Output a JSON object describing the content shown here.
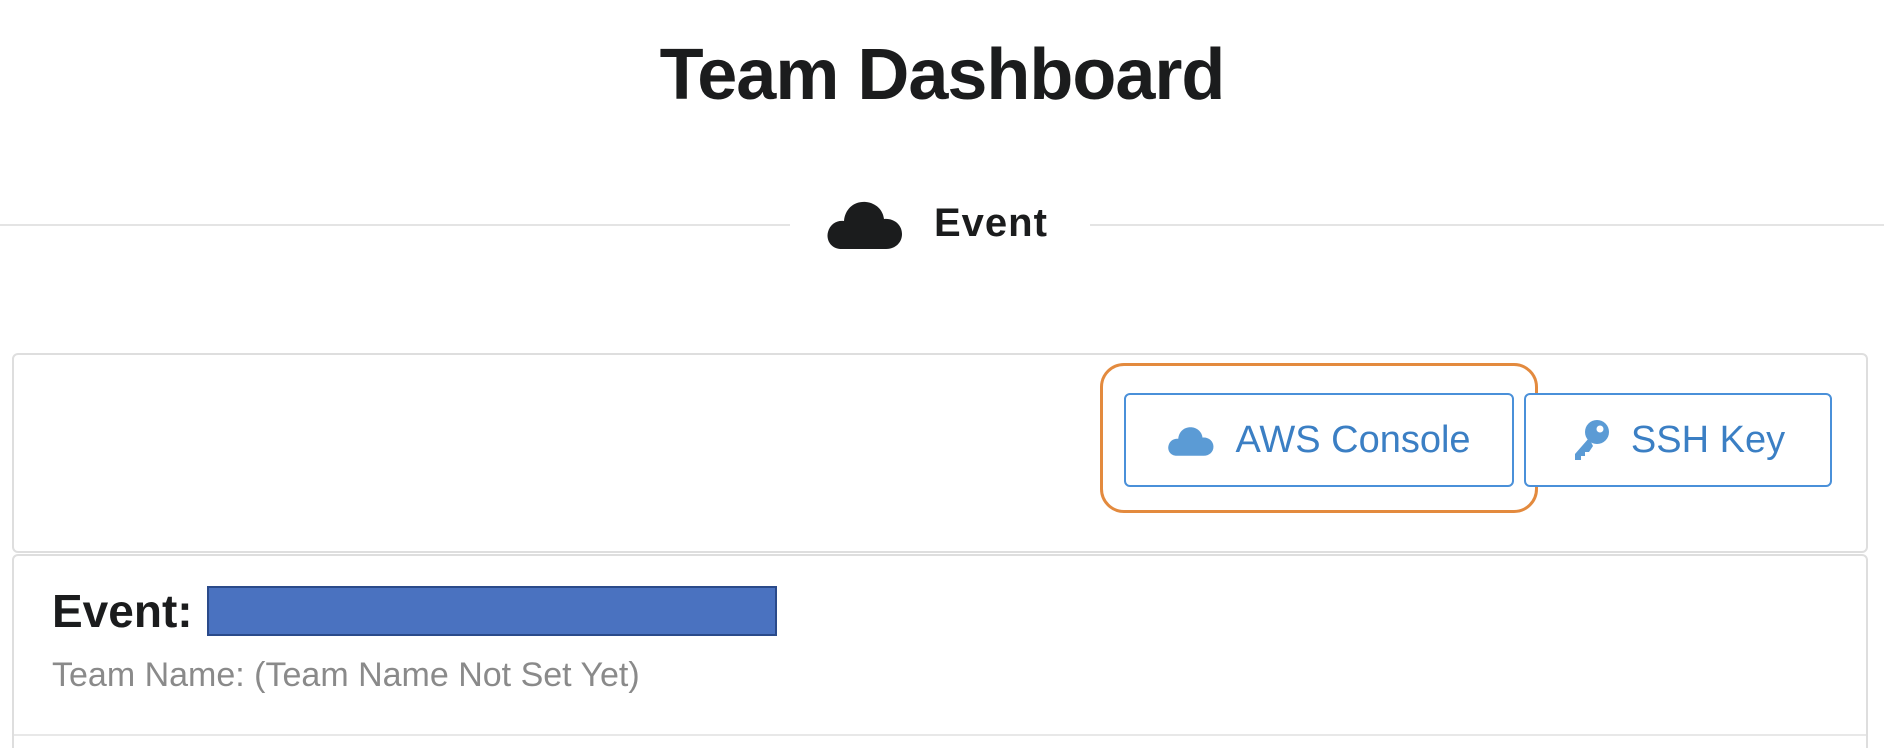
{
  "page": {
    "title": "Team Dashboard"
  },
  "section_divider": {
    "label": "Event",
    "icon": "cloud-icon"
  },
  "actions": {
    "aws_console": {
      "label": "AWS Console",
      "icon": "cloud-icon"
    },
    "ssh_key": {
      "label": "SSH Key",
      "icon": "key-icon"
    },
    "highlight_color": "#e38a3e",
    "accent_color": "#3b7fc4"
  },
  "event": {
    "label": "Event:",
    "name_redacted": true,
    "team_name_text": "Team Name: (Team Name Not Set Yet)"
  }
}
